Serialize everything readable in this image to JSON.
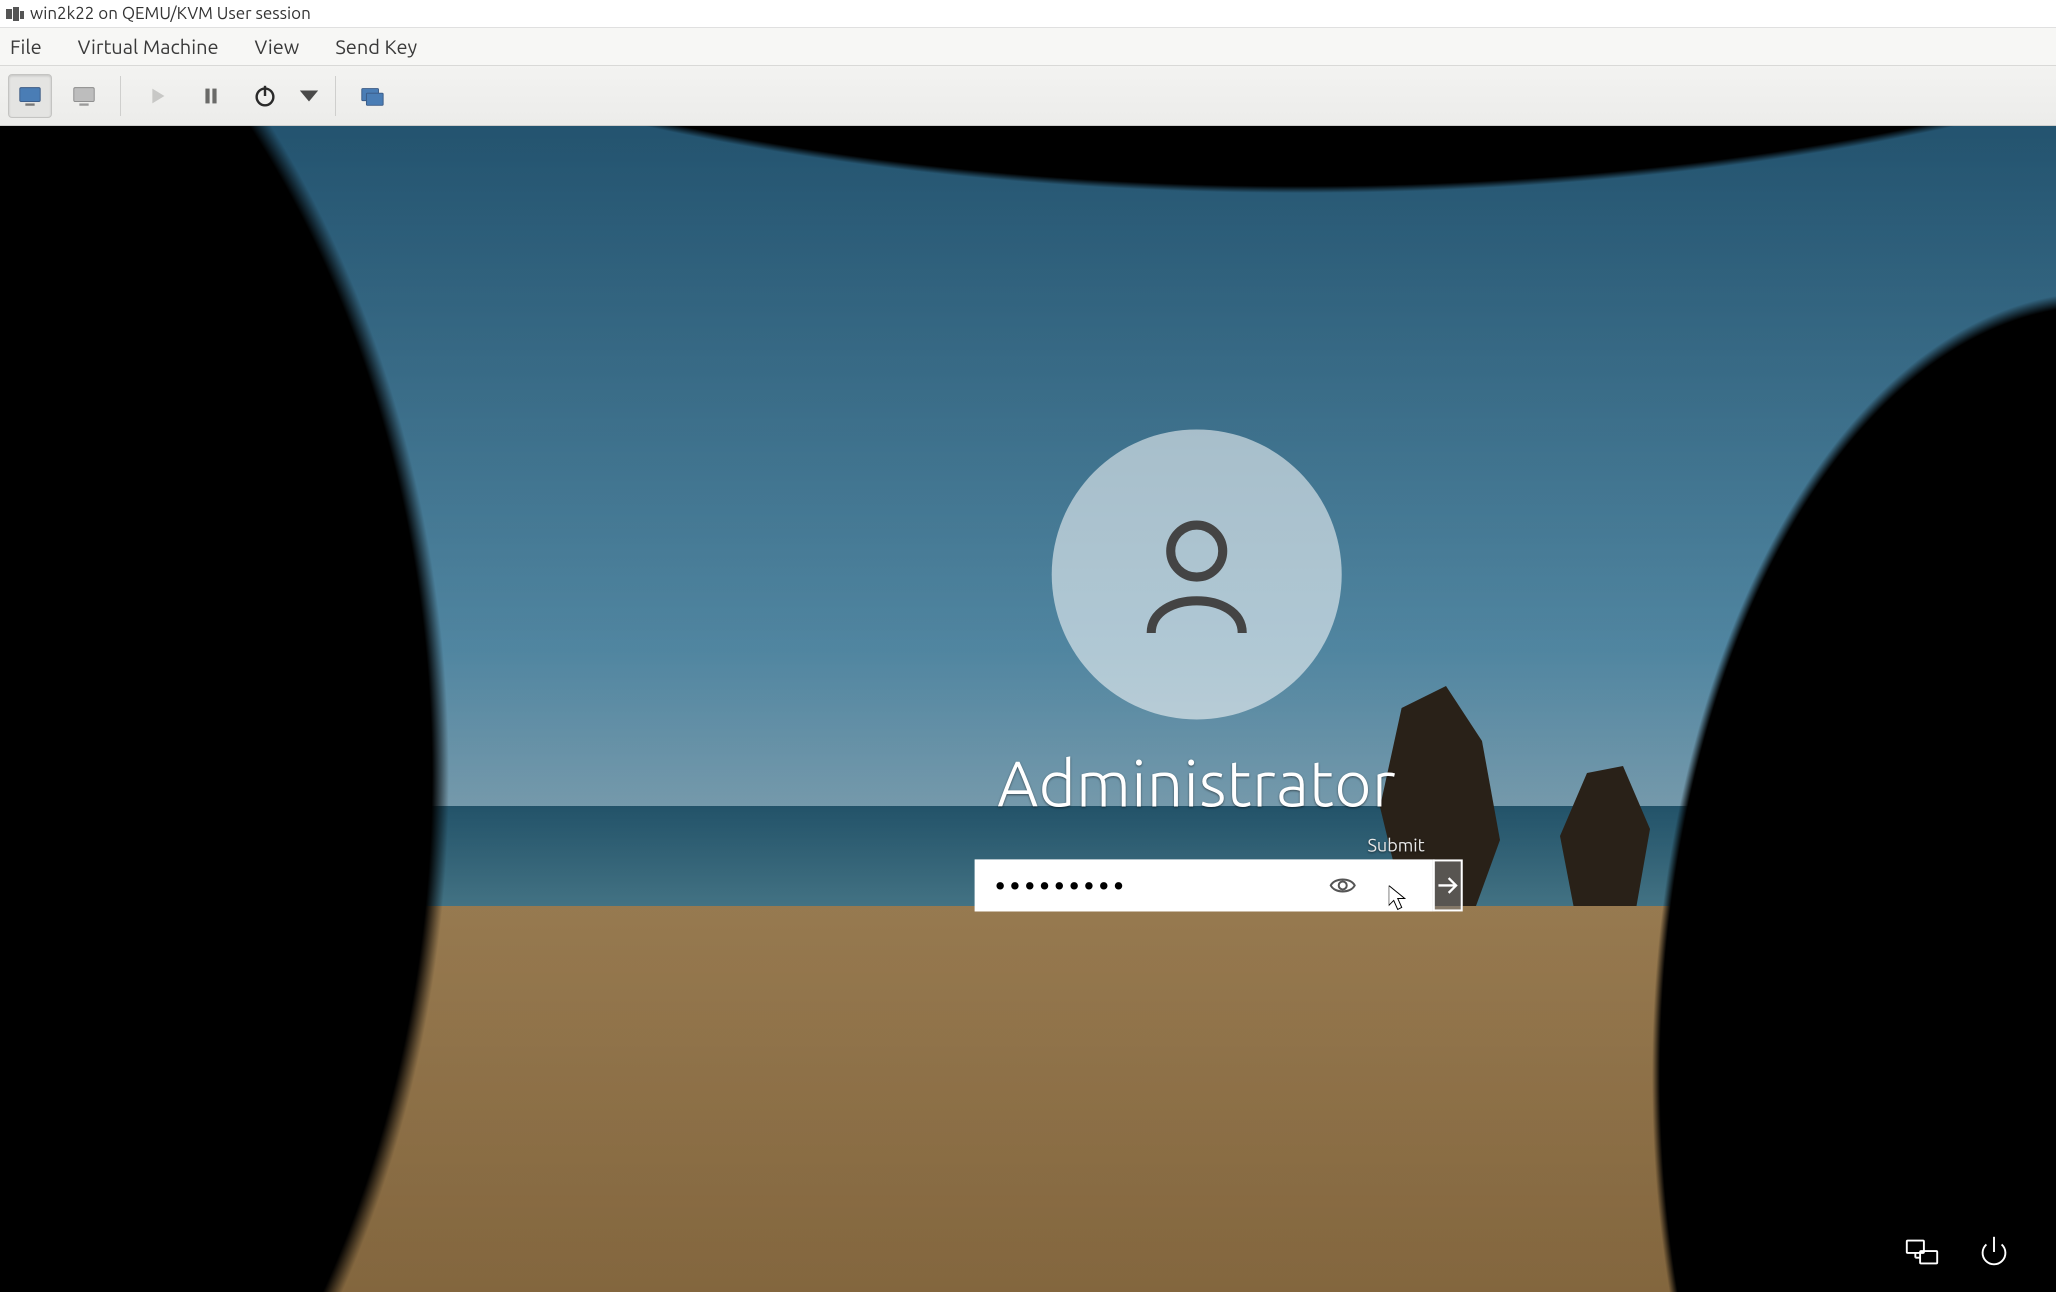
{
  "host": {
    "title": "win2k22 on QEMU/KVM User session",
    "menus": {
      "file": "File",
      "vm": "Virtual Machine",
      "view": "View",
      "sendkey": "Send Key"
    }
  },
  "guest": {
    "username": "Administrator",
    "password_display": "●●●●●●●●●",
    "submit_hint": "Submit"
  }
}
